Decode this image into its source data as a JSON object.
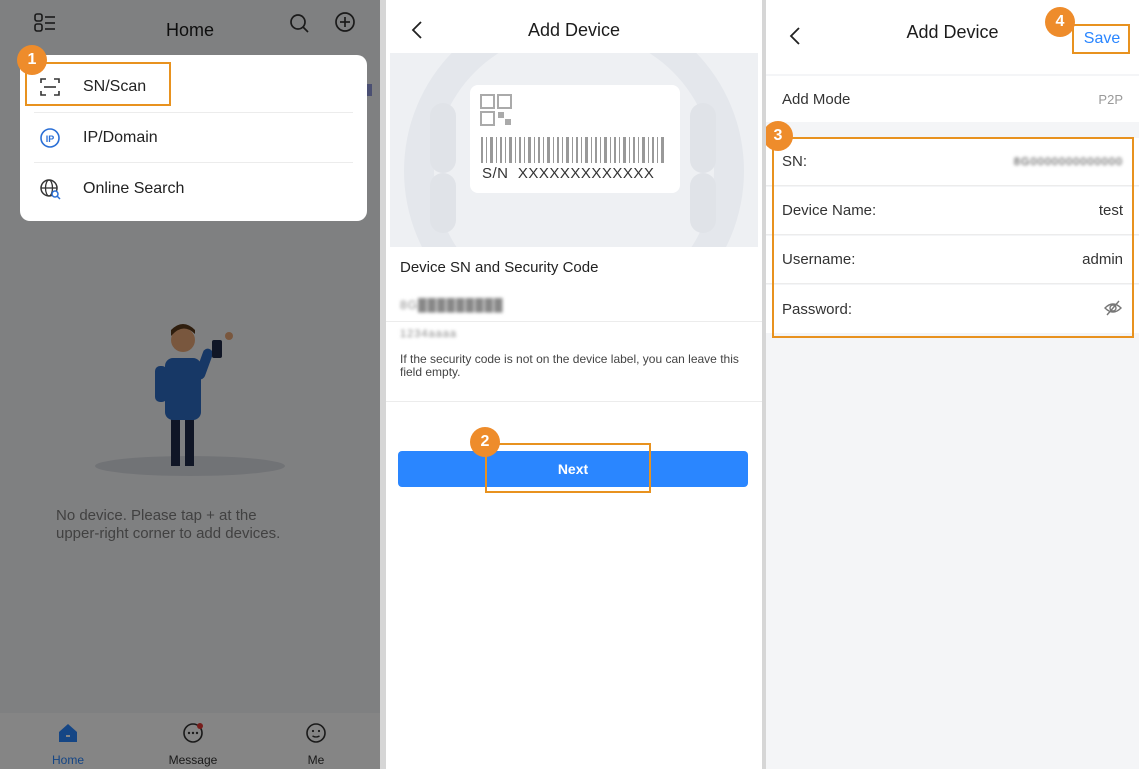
{
  "home": {
    "title": "Home",
    "empty_line1": "No device. Please tap + at the",
    "empty_line2": "upper-right corner to add devices.",
    "menu": [
      "SN/Scan",
      "IP/Domain",
      "Online Search"
    ],
    "tabs": [
      "Home",
      "Message",
      "Me"
    ]
  },
  "scan": {
    "title": "Add Device",
    "label_sn": "S/N  XXXXXXXXXXXXX",
    "section_title": "Device SN and Security Code",
    "sn_value": "8G█████████",
    "code_value": "1234aaaa",
    "hint": "If the security code is not on the device label, you can leave this field empty.",
    "next_label": "Next"
  },
  "form": {
    "title": "Add Device",
    "save_label": "Save",
    "mode_label": "Add Mode",
    "mode_value": "P2P",
    "sn_label": "SN:",
    "sn_value": "8G0000000000000",
    "name_label": "Device Name:",
    "name_value": "test",
    "user_label": "Username:",
    "user_value": "admin",
    "pass_label": "Password:"
  },
  "steps": [
    "1",
    "2",
    "3",
    "4"
  ],
  "colors": {
    "accent": "#2a86ff",
    "highlight": "#e8921f",
    "badge": "#ee8c2b"
  }
}
